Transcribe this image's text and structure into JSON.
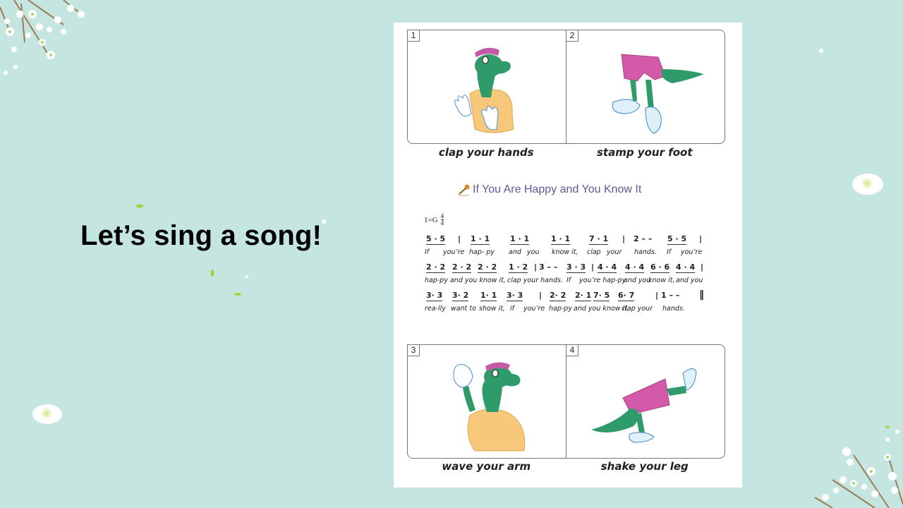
{
  "slide": {
    "title": "Let’s sing a song!",
    "background_color": "#c5e5e1"
  },
  "page": {
    "top_panels": [
      {
        "number": "1",
        "caption": "clap your hands",
        "illustration": "turtle-clapping-hands"
      },
      {
        "number": "2",
        "caption": "stamp your foot",
        "illustration": "legs-stamping-foot"
      }
    ],
    "bottom_panels": [
      {
        "number": "3",
        "caption": "wave your arm",
        "illustration": "turtle-waving-arm"
      },
      {
        "number": "4",
        "caption": "shake your leg",
        "illustration": "legs-shaking-leg"
      }
    ],
    "song": {
      "icon": "microphone-icon",
      "title": "If You Are Happy and You Know It",
      "title_color": "#5b5a9a",
      "key": "1=G",
      "time_signature": {
        "top": "4",
        "bottom": "4"
      },
      "lines": [
        {
          "notes": [
            "5 · 5",
            "|",
            "1 · 1",
            "1 · 1",
            "1 · 1",
            "7 · 1",
            "|",
            "2 – –",
            "5 · 5",
            "|"
          ],
          "lyrics": [
            "If",
            "you’re",
            "hap- py",
            "and",
            "you",
            "know it,",
            "clap",
            "your",
            "hands.",
            "If",
            "you’re"
          ]
        },
        {
          "notes": [
            "2 · 2",
            "2 · 2",
            "2 ·  2",
            "1 · 2",
            "|",
            "3 – –",
            "3 · 3",
            "|",
            "4 · 4",
            "4 · 4",
            "6 · 6",
            "4 · 4",
            "|"
          ],
          "lyrics": [
            "hap-py and you know it,",
            "clap your hands.",
            "If",
            "you’re hap-py",
            "and you",
            "know it,",
            "and you"
          ]
        },
        {
          "notes": [
            "3· 3",
            "3· 2",
            "1· 1",
            "3·  3",
            "|",
            "2· 2",
            "2· 1",
            "7· 5",
            "6·  7",
            "|",
            "1  –  –",
            "‖"
          ],
          "lyrics": [
            "rea-lly",
            "want to",
            "show it,",
            "if",
            "you’re",
            "hap-py",
            "and you know it,",
            "clap your",
            "hands."
          ]
        }
      ]
    }
  }
}
